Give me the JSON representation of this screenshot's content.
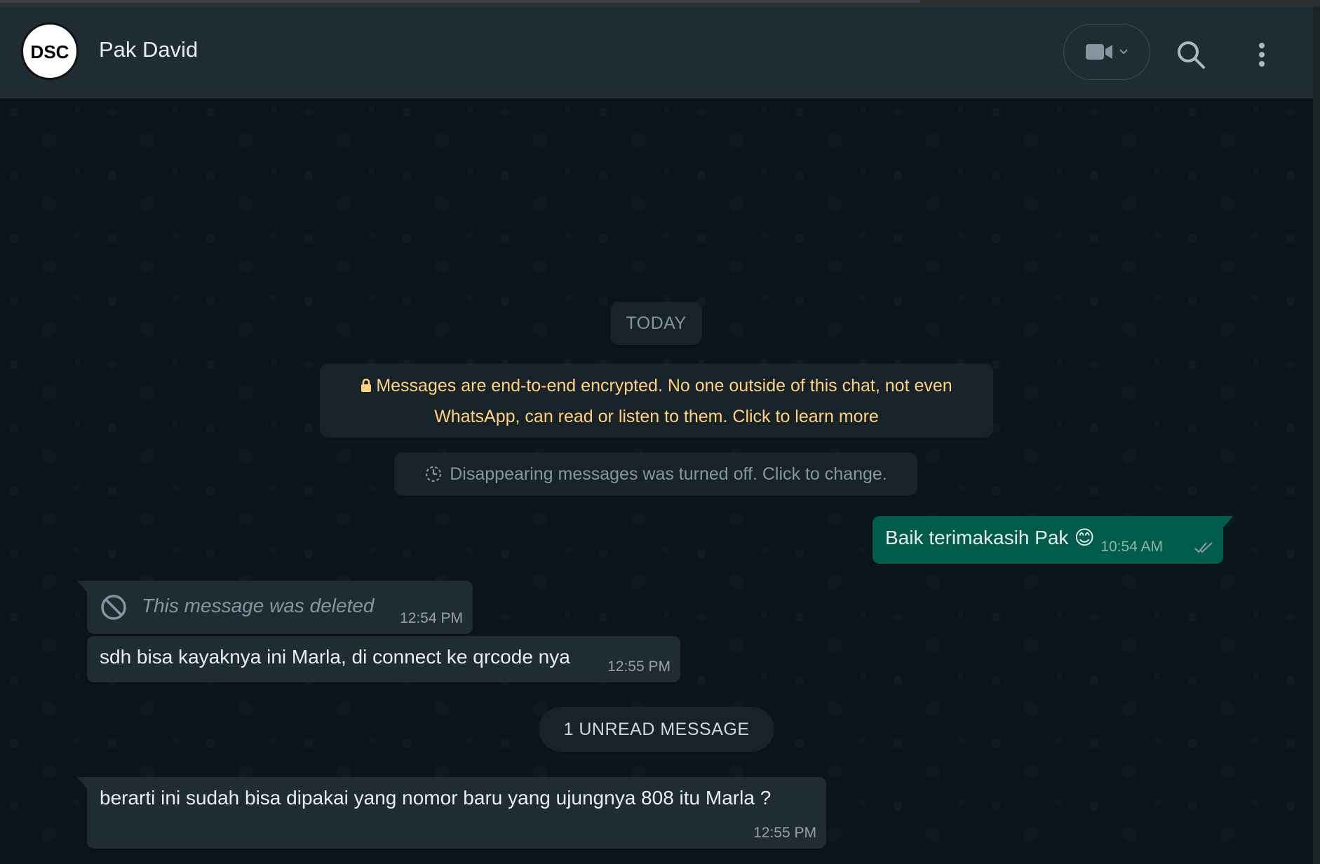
{
  "header": {
    "contact_name": "Pak David",
    "avatar_text": "DSC"
  },
  "chat": {
    "date_label": "TODAY",
    "encryption_notice": "Messages are end-to-end encrypted. No one outside of this chat, not even WhatsApp, can read or listen to them. Click to learn more",
    "disappearing_notice": "Disappearing messages was turned off. Click to change.",
    "messages": [
      {
        "direction": "out",
        "text": "Baik terimakasih Pak",
        "emoji": "😊",
        "time": "10:54 AM",
        "status": "read"
      },
      {
        "direction": "in",
        "text": "This message was deleted",
        "time": "12:54 PM",
        "deleted": true
      },
      {
        "direction": "in",
        "text": "sdh bisa kayaknya ini Marla, di connect ke qrcode nya",
        "time": "12:55 PM"
      },
      {
        "direction": "in",
        "text": "berarti ini sudah bisa dipakai yang nomor baru yang ujungnya 808 itu Marla ?",
        "time": "12:55 PM"
      }
    ],
    "unread_label": "1 UNREAD MESSAGE"
  },
  "colors": {
    "header_bg": "#202c33",
    "chat_bg": "#0b141a",
    "outgoing_bubble": "#005c4b",
    "incoming_bubble": "#202c33",
    "encryption_text": "#ffd279",
    "read_ticks": "#8696a0"
  },
  "icons": {
    "video_call": "video-camera-icon",
    "search": "search-icon",
    "menu": "kebab-menu-icon",
    "lock": "lock-icon",
    "timer": "timer-icon",
    "deleted": "ban-icon",
    "ticks": "double-check-icon"
  }
}
